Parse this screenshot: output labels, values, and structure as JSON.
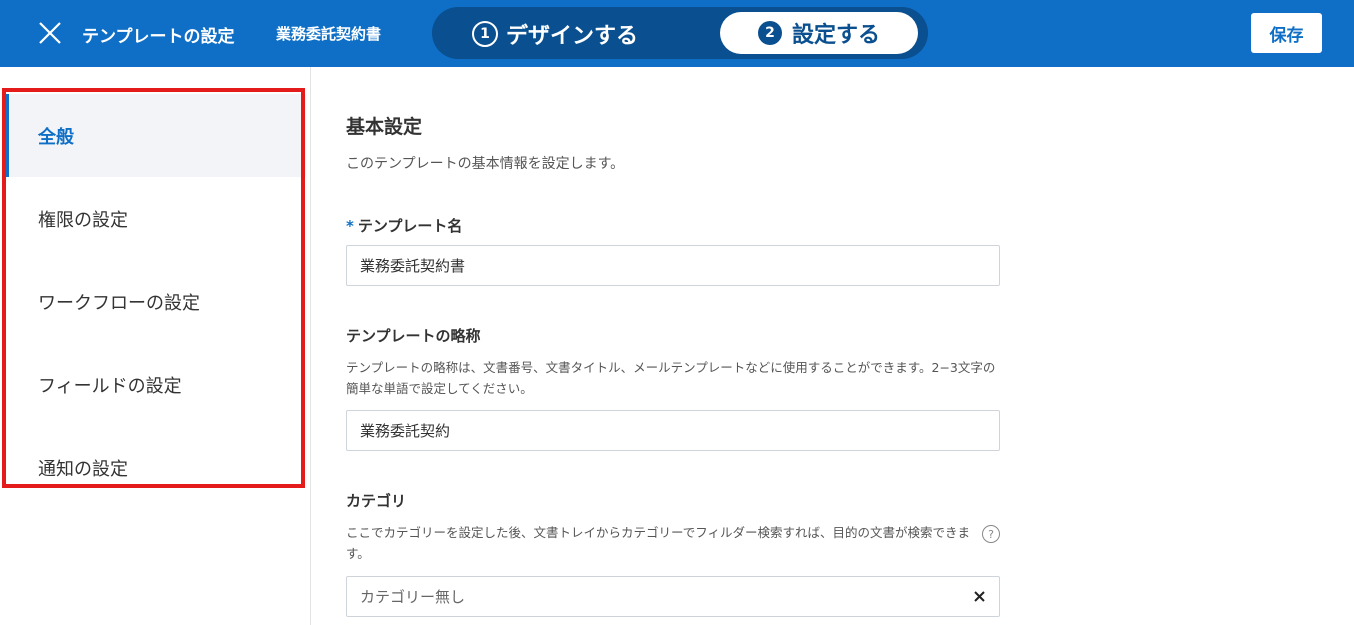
{
  "header": {
    "app_title": "テンプレートの設定",
    "doc_title": "業務委託契約書",
    "steps": [
      {
        "num": "1",
        "label": "デザインする"
      },
      {
        "num": "2",
        "label": "設定する"
      }
    ],
    "save_label": "保存",
    "close_icon": "close-icon"
  },
  "sidebar": {
    "items": [
      {
        "label": "全般",
        "active": true
      },
      {
        "label": "権限の設定"
      },
      {
        "label": "ワークフローの設定"
      },
      {
        "label": "フィールドの設定"
      },
      {
        "label": "通知の設定"
      }
    ]
  },
  "main": {
    "section_title": "基本設定",
    "section_desc": "このテンプレートの基本情報を設定します。",
    "template_name": {
      "required_mark": "*",
      "label": "テンプレート名",
      "value": "業務委託契約書"
    },
    "abbreviation": {
      "label": "テンプレートの略称",
      "help": "テンプレートの略称は、文書番号、文書タイトル、メールテンプレートなどに使用することができます。2−3文字の簡単な単語で設定してください。",
      "value": "業務委託契約"
    },
    "category": {
      "label": "カテゴリ",
      "help": "ここでカテゴリーを設定した後、文書トレイからカテゴリーでフィルダー検索すれば、目的の文書が検索できます。",
      "help_icon": "?",
      "placeholder": "カテゴリー無し",
      "clear_icon": "close-icon"
    }
  },
  "colors": {
    "header_bg": "#0f6fc6",
    "stepper_bg": "#0a4f8f",
    "accent": "#0f6fc6",
    "highlight_border": "#e41b1b"
  }
}
